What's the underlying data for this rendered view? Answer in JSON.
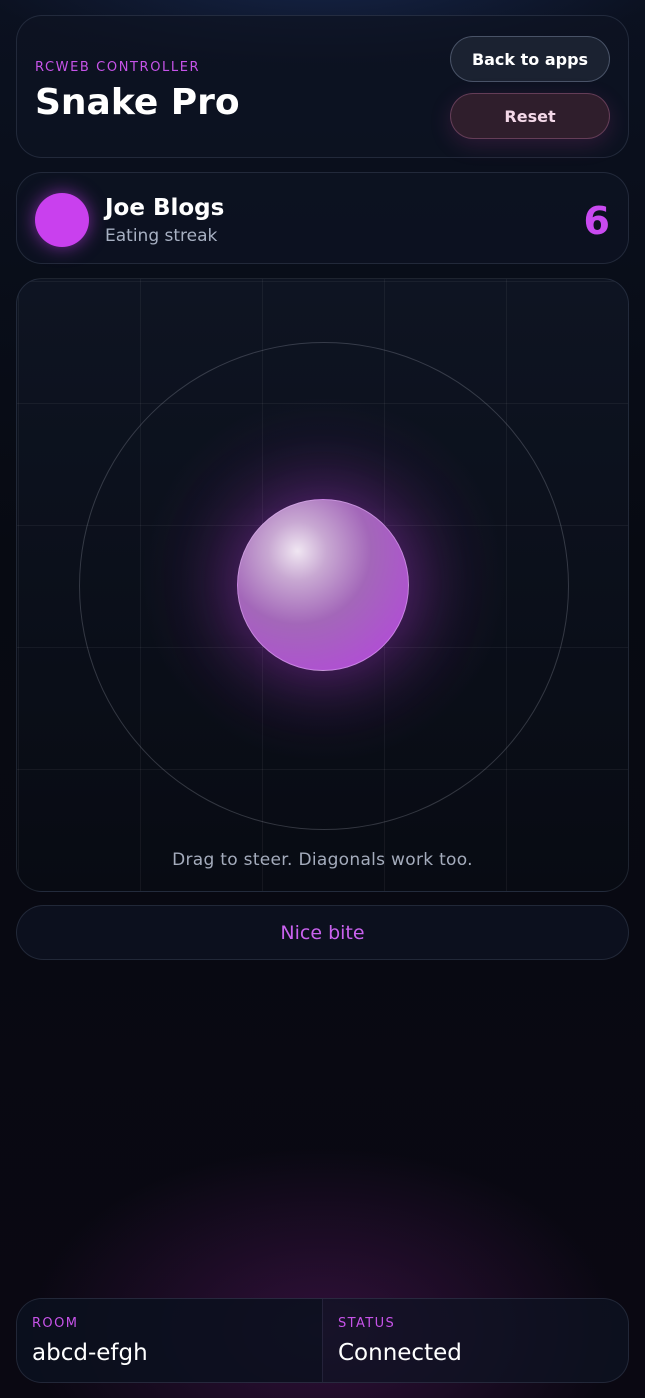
{
  "header": {
    "eyebrow": "RCWEB CONTROLLER",
    "title": "Snake Pro",
    "back_label": "Back to apps",
    "reset_label": "Reset"
  },
  "player": {
    "name": "Joe Blogs",
    "subtitle": "Eating streak",
    "score": "6",
    "color": "#c940ee"
  },
  "joystick": {
    "hint": "Drag to steer. Diagonals work too."
  },
  "message": "Nice bite",
  "footer": {
    "room_label": "ROOM",
    "room_value": "abcd-efgh",
    "status_label": "STATUS",
    "status_value": "Connected"
  },
  "colors": {
    "accent": "#c94af0",
    "background": "#070a12"
  }
}
